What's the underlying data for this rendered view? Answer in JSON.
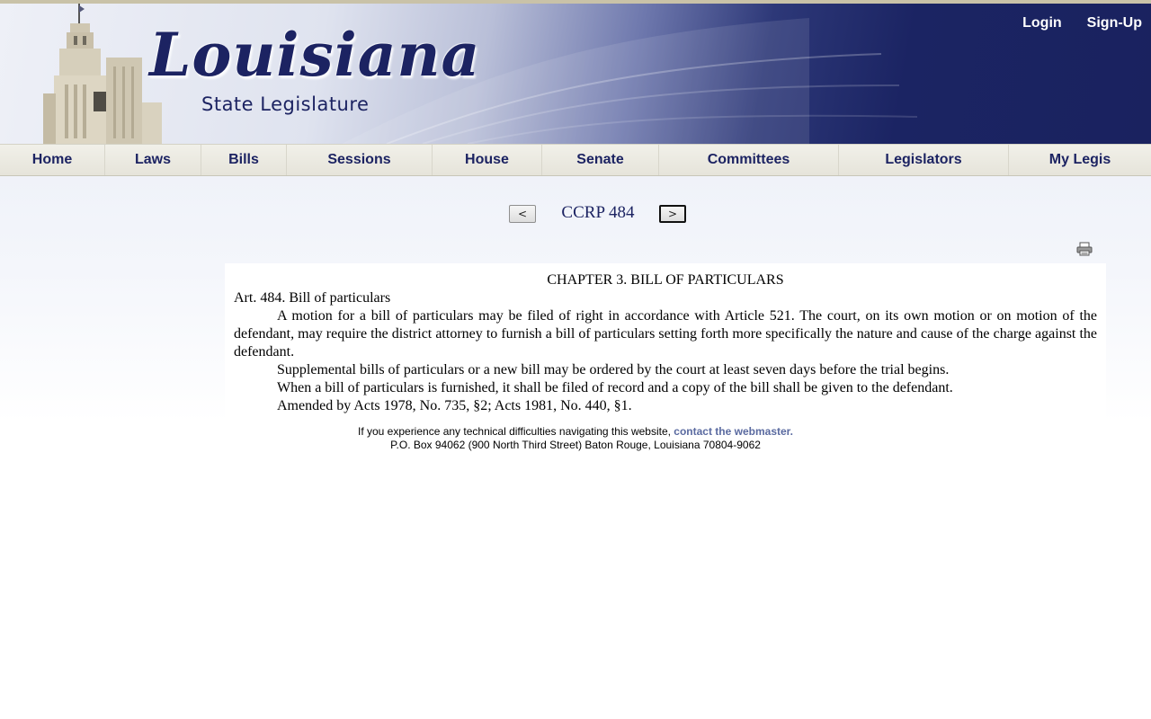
{
  "header": {
    "logo_word": "Louisiana",
    "logo_sub": "State Legislature",
    "login_label": "Login",
    "signup_label": "Sign-Up"
  },
  "nav": {
    "items": [
      {
        "label": "Home"
      },
      {
        "label": "Laws"
      },
      {
        "label": "Bills"
      },
      {
        "label": "Sessions"
      },
      {
        "label": "House"
      },
      {
        "label": "Senate"
      },
      {
        "label": "Committees"
      },
      {
        "label": "Legislators"
      },
      {
        "label": "My Legis"
      }
    ]
  },
  "doc_nav": {
    "prev_label": "<",
    "next_label": ">",
    "title": "CCRP 484"
  },
  "icons": {
    "print": "printer-icon"
  },
  "document": {
    "chapter": "CHAPTER 3.  BILL OF PARTICULARS",
    "article": "Art. 484.  Bill of particulars",
    "paragraphs": [
      "A motion for a bill of particulars may be filed of right in accordance with Article 521.  The court, on its own motion or on motion of the defendant, may require the district attorney to furnish a bill of particulars setting forth more specifically the nature and cause of the charge against the defendant.",
      "Supplemental bills of particulars or a new bill may be ordered by the court at least seven days before the trial begins.",
      "When a bill of particulars is furnished, it shall be filed of record and a copy of the bill shall be given to the defendant.",
      "Amended by Acts 1978, No. 735, §2; Acts 1981, No. 440, §1."
    ]
  },
  "footer": {
    "help_text": "If you experience any technical difficulties navigating this website, ",
    "webmaster_link": "contact the webmaster.",
    "address": "P.O. Box 94062 (900 North Third Street) Baton Rouge, Louisiana 70804-9062"
  },
  "colors": {
    "brand_navy": "#1c2362",
    "link_blue": "#5a6aa0",
    "nav_bg": "#ecebe3"
  }
}
